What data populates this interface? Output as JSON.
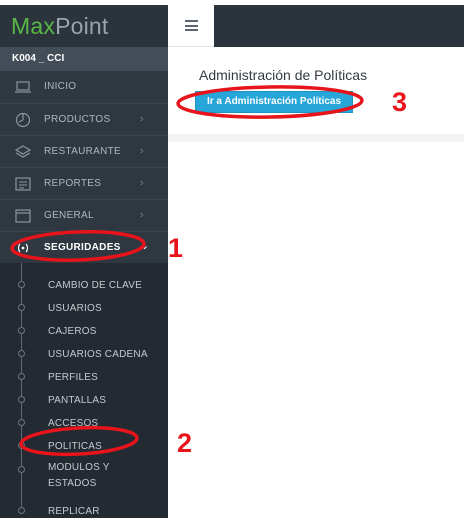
{
  "brand": {
    "part1": "Max",
    "part2": "Point"
  },
  "user": {
    "label": "K004 _ CCI"
  },
  "menu": [
    {
      "label": "INICIO",
      "icon": "monitor-icon",
      "chevron": ""
    },
    {
      "label": "PRODUCTOS",
      "icon": "clock-icon",
      "chevron": "›"
    },
    {
      "label": "RESTAURANTE",
      "icon": "layers-icon",
      "chevron": "›"
    },
    {
      "label": "REPORTES",
      "icon": "report-icon",
      "chevron": "›"
    },
    {
      "label": "GENERAL",
      "icon": "window-icon",
      "chevron": "›"
    },
    {
      "label": "SEGURIDADES",
      "icon": "shield-icon",
      "chevron": "⌄"
    }
  ],
  "submenu": [
    {
      "label": "CAMBIO DE CLAVE"
    },
    {
      "label": "USUARIOS"
    },
    {
      "label": "CAJEROS"
    },
    {
      "label": "USUARIOS CADENA"
    },
    {
      "label": "PERFILES"
    },
    {
      "label": "PANTALLAS"
    },
    {
      "label": "ACCESOS"
    },
    {
      "label": "POLITICAS"
    },
    {
      "label": "MODULOS Y\nESTADOS"
    },
    {
      "label": "REPLICAR"
    }
  ],
  "header": {
    "menu_icon": "hamburger-icon"
  },
  "panel": {
    "title": "Administración de Políticas",
    "button": "Ir a Administración Políticas"
  },
  "annotations": {
    "n1": "1",
    "n2": "2",
    "n3": "3",
    "color": "#e8141c"
  },
  "colors": {
    "brand_green": "#58b847",
    "button_blue": "#27a6d9",
    "sidebar": "#2f3740"
  }
}
